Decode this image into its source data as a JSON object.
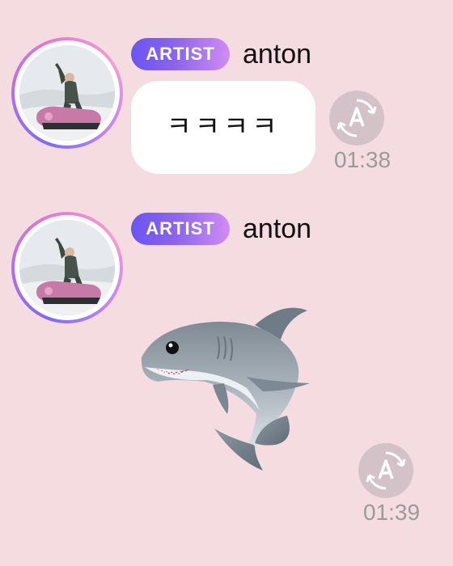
{
  "colors": {
    "background": "#f5dce1",
    "badge_start": "#6b55f0",
    "badge_end": "#d08cf2",
    "bubble": "#ffffff",
    "timestamp": "#9b9b9b",
    "translate_button": "#d3c3c8"
  },
  "messages": [
    {
      "badge": "ARTIST",
      "username": "anton",
      "text": "ㅋㅋㅋㅋ",
      "time": "01:38",
      "translate_icon": "translate-icon"
    },
    {
      "badge": "ARTIST",
      "username": "anton",
      "sticker": "shark-sticker",
      "time": "01:39",
      "translate_icon": "translate-icon"
    }
  ]
}
